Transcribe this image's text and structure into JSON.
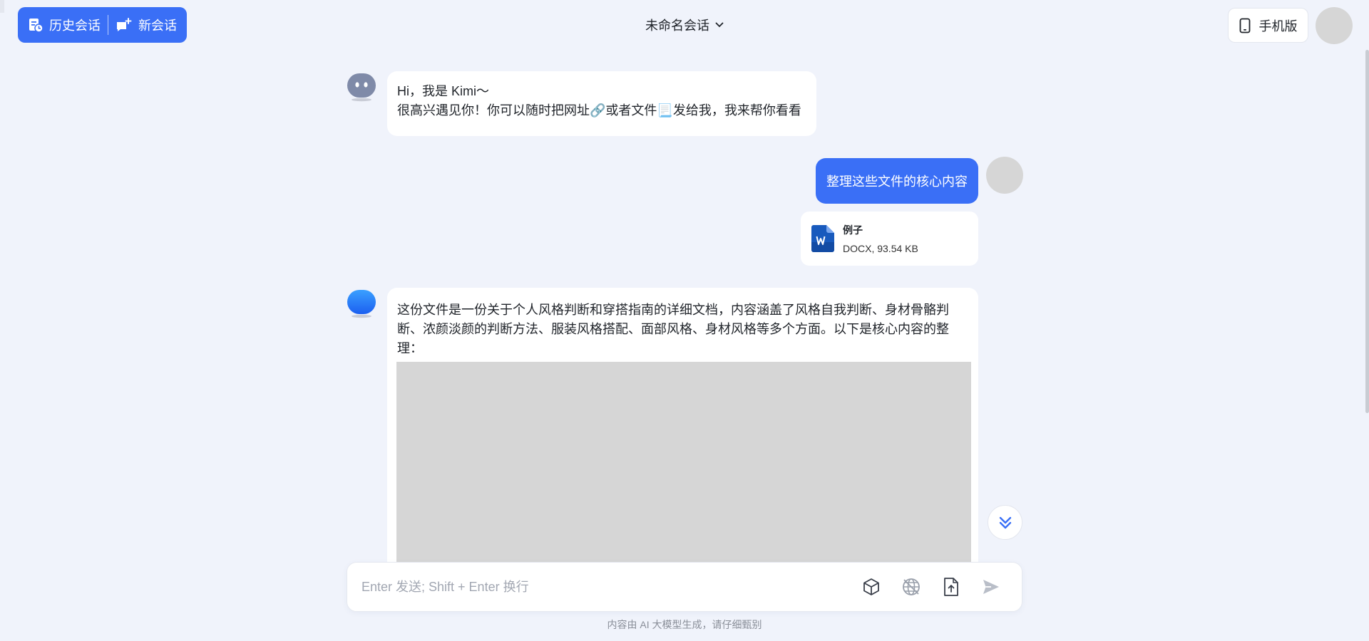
{
  "header": {
    "history_label": "历史会话",
    "new_chat_label": "新会话",
    "title": "未命名会话",
    "mobile_label": "手机版"
  },
  "messages": {
    "greeting_line1": "Hi，我是 Kimi～",
    "greeting_line2": "很高兴遇见你！你可以随时把网址🔗或者文件📃发给我，我来帮你看看",
    "user_message": "整理这些文件的核心内容",
    "attachment": {
      "name": "例子",
      "meta": "DOCX, 93.54 KB"
    },
    "reply_text": "这份文件是一份关于个人风格判断和穿搭指南的详细文档，内容涵盖了风格自我判断、身材骨骼判断、浓颜淡颜的判断方法、服装风格搭配、面部风格、身材风格等多个方面。以下是核心内容的整理："
  },
  "input": {
    "placeholder": "Enter 发送; Shift + Enter 换行"
  },
  "footer": {
    "note": "内容由 AI 大模型生成，请仔细甄别"
  },
  "colors": {
    "accent": "#3a6ff6",
    "background": "#f0f3fb",
    "word_blue": "#185abd"
  },
  "icons": {
    "history": "history-icon",
    "new_chat": "new-chat-icon",
    "chevron": "chevron-down-icon",
    "mobile": "phone-icon",
    "scroll_down": "double-chevron-down-icon",
    "tools": [
      "cube-icon",
      "globe-off-icon",
      "upload-file-icon",
      "send-icon"
    ]
  }
}
